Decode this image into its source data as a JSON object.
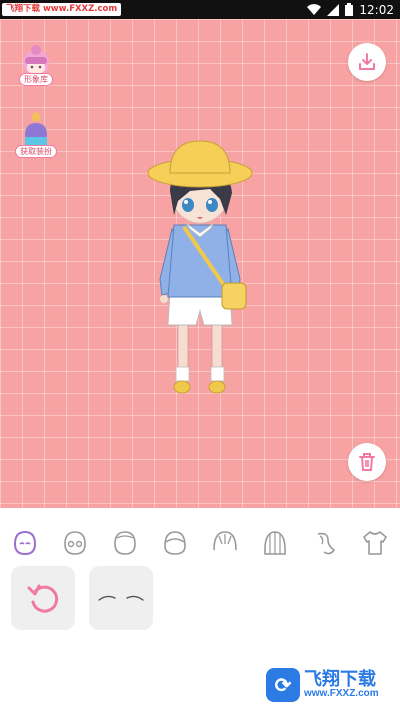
{
  "statusbar": {
    "watermark": "飞翔下载 www.FXXZ.com",
    "time": "12:02",
    "icons": [
      "wifi-icon",
      "signal-icon",
      "battery-icon"
    ]
  },
  "side_buttons": [
    {
      "label": "形象库",
      "icon": "character-avatar-icon"
    },
    {
      "label": "获取装扮",
      "icon": "potion-bottle-icon"
    }
  ],
  "actions": {
    "save_icon": "download-icon",
    "delete_icon": "trash-icon"
  },
  "tabs": [
    {
      "id": "face",
      "icon": "face-icon",
      "active": true
    },
    {
      "id": "eyes",
      "icon": "eyes-icon",
      "active": false
    },
    {
      "id": "head",
      "icon": "head-shape-icon",
      "active": false
    },
    {
      "id": "hair-front",
      "icon": "hair-front-icon",
      "active": false
    },
    {
      "id": "hair-side",
      "icon": "hair-side-icon",
      "active": false
    },
    {
      "id": "hair-back",
      "icon": "hair-back-icon",
      "active": false
    },
    {
      "id": "accessory",
      "icon": "hair-accessory-icon",
      "active": false
    },
    {
      "id": "clothes",
      "icon": "tshirt-icon",
      "active": false
    }
  ],
  "options": [
    {
      "id": "reset",
      "icon": "reset-icon"
    },
    {
      "id": "eyebrows",
      "icon": "eyebrows-icon"
    }
  ],
  "bottom_watermark": {
    "title": "飞翔下载",
    "url": "www.FXXZ.com"
  },
  "colors": {
    "canvas_bg": "#f8a3a3",
    "accent": "#f27aa0",
    "active_tab": "#9b6ed1"
  }
}
